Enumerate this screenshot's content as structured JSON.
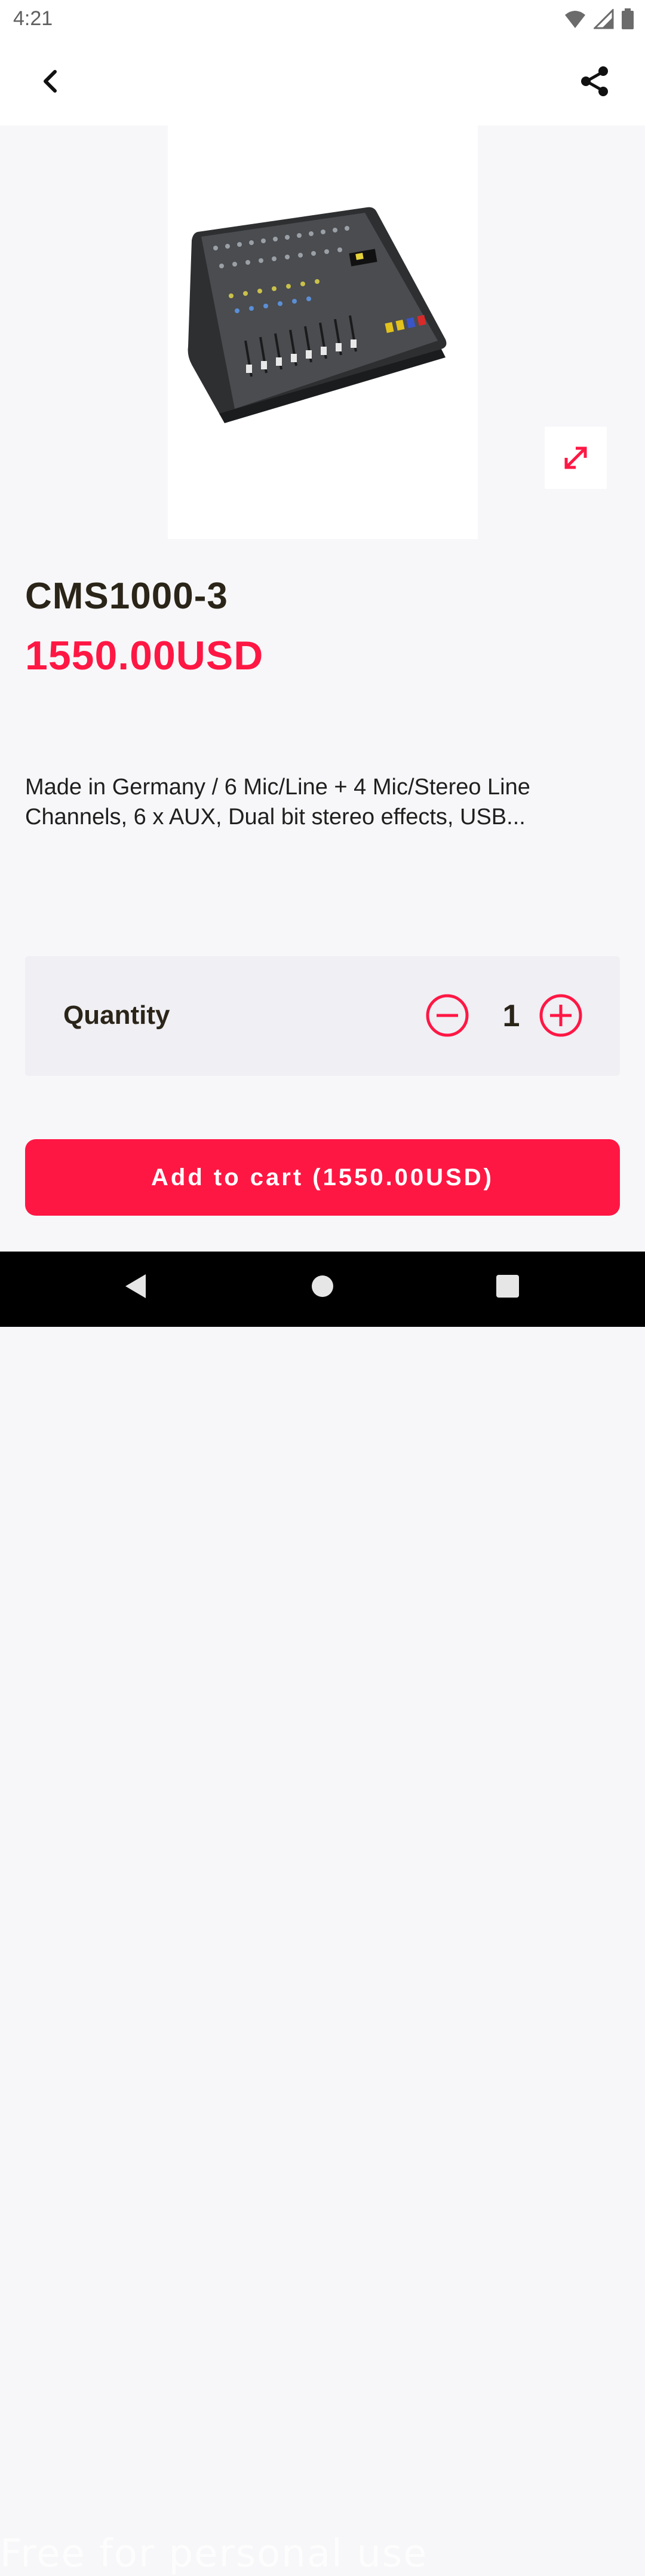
{
  "status_bar": {
    "time": "4:21",
    "icons": [
      "wifi-icon",
      "signal-icon",
      "battery-icon"
    ]
  },
  "app_bar": {
    "back_icon": "chevron-left-icon",
    "share_icon": "share-icon"
  },
  "gallery": {
    "image": "audio mixing console",
    "expand_icon": "expand-icon"
  },
  "product": {
    "name": "CMS1000-3",
    "price": "1550.00USD",
    "description": "Made in Germany / 6 Mic/Line + 4 Mic/Stereo Line Channels, 6 x AUX, Dual bit stereo effects, USB..."
  },
  "quantity": {
    "label": "Quantity",
    "value": "1",
    "minus_icon": "minus-circle-icon",
    "plus_icon": "plus-circle-icon"
  },
  "cart": {
    "button_label": "Add to cart (1550.00USD)"
  },
  "nav_bar": {
    "icons": [
      "back-triangle-icon",
      "home-circle-icon",
      "recents-square-icon"
    ]
  },
  "watermark": "Free for personal use",
  "colors": {
    "accent": "#ff1744",
    "text_dark": "#2b2519",
    "card_bg": "#efeff4",
    "page_bg": "#f7f7f9"
  }
}
